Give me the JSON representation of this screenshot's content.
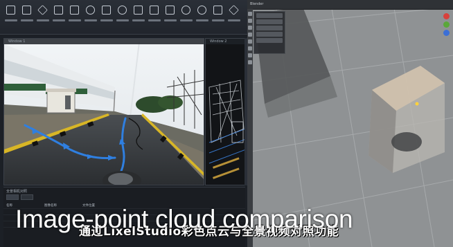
{
  "left_app": {
    "toolbar": [
      {
        "icon": "save-icon"
      },
      {
        "icon": "export-icon"
      },
      {
        "icon": "scene-icon"
      },
      {
        "icon": "cube-icon"
      },
      {
        "icon": "frame-icon"
      },
      {
        "icon": "color-icon"
      },
      {
        "icon": "measure-icon"
      },
      {
        "icon": "rotate-icon"
      },
      {
        "icon": "mesh-icon"
      },
      {
        "icon": "compare-icon"
      },
      {
        "icon": "filter-icon"
      },
      {
        "icon": "settings-icon"
      },
      {
        "icon": "target-icon"
      },
      {
        "icon": "tree-icon"
      },
      {
        "icon": "plugin-icon"
      }
    ],
    "viewport1_title": "Window 1",
    "viewport2_title": "Window 2",
    "bottom_panel": {
      "title": "全景相机对照",
      "headers": [
        "名称",
        "图像名称",
        "文件位置"
      ]
    }
  },
  "right_app": {
    "header_title": "Blender"
  },
  "captions": {
    "chinese": "通过LixelStudio彩色点云与全景视频对照功能",
    "english": "Image-point cloud comparison"
  },
  "colors": {
    "accent_blue": "#2f7fe0",
    "toolbar_bg": "#2a2f37"
  }
}
